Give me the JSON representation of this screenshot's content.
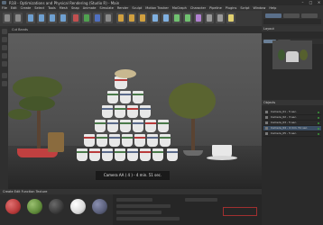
{
  "window": {
    "title": "R18 - Optimizations and Physical Rendering (Studio R) - Main",
    "controls": [
      "–",
      "□",
      "×"
    ]
  },
  "menu": {
    "items": [
      "File",
      "Edit",
      "Create",
      "Select",
      "Tools",
      "Mesh",
      "Snap",
      "Animate",
      "Simulate",
      "Render",
      "Sculpt",
      "Motion Tracker",
      "MoGraph",
      "Character",
      "Pipeline",
      "Plugins",
      "Script",
      "Window",
      "Help"
    ]
  },
  "toolbar": {
    "icons": [
      "undo-icon",
      "redo-icon",
      "select-icon",
      "move-icon",
      "scale-icon",
      "rotate-icon",
      "x-axis-icon",
      "y-axis-icon",
      "z-axis-icon",
      "coord-icon",
      "render-view-icon",
      "render-picture-icon",
      "render-settings-icon",
      "cube-icon",
      "pen-icon",
      "subdivision-icon",
      "array-icon",
      "deformer-icon",
      "floor-icon",
      "camera-icon",
      "light-icon"
    ]
  },
  "viewport": {
    "header_label": "Cut Bands",
    "overlay_text": "Camera AA ( 4 ) - 4 min. 51 sec."
  },
  "right_panel": {
    "header_label": "Layout",
    "tabs": [
      "Picture Viewer",
      "Navigator"
    ],
    "objects_header": "Objects",
    "objects": [
      {
        "name": "Camera_01 - 5 sec.",
        "selected": false
      },
      {
        "name": "Camera_02 - 3 sec.",
        "selected": false
      },
      {
        "name": "Camera_03 - 5 sec.",
        "selected": false
      },
      {
        "name": "Camera_04 - 4 min. 51 sec.",
        "selected": true
      },
      {
        "name": "Camera_05 - 5 sec.",
        "selected": false
      }
    ]
  },
  "bottom": {
    "material_header": "Create  Edit  Function  Texture",
    "materials": [
      "#b83a3a",
      "#5f8a3a",
      "#3a3a3a",
      "#d9d9d9",
      "#5a5f7a"
    ]
  },
  "colors": {
    "accent": "#5a6f8a",
    "selection": "#3b4e63",
    "pot_red": "#c04040"
  }
}
